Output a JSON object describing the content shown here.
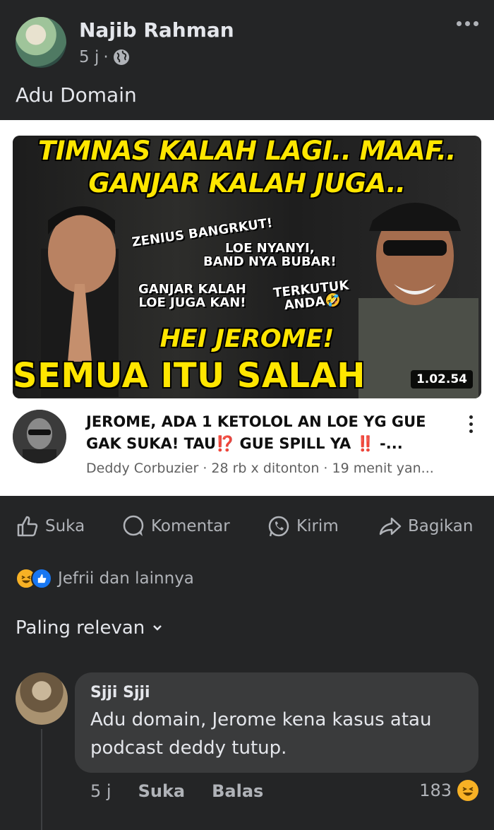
{
  "post": {
    "author": "Najib Rahman",
    "time": "5 j",
    "text": "Adu Domain"
  },
  "link_card": {
    "thumbnail": {
      "headline_1": "TIMNAS KALAH LAGI.. MAAF..",
      "headline_2": "GANJAR KALAH JUGA..",
      "caption_1": "ZENIUS BANGRKUT!",
      "caption_2_line1": "LOE NYANYI,",
      "caption_2_line2": "BAND NYA BUBAR!",
      "caption_3_line1": "GANJAR KALAH",
      "caption_3_line2": "LOE JUGA KAN!",
      "caption_4_line1": "TERKUTUK",
      "caption_4_line2": "ANDA🤣",
      "headline_3": "HEI JEROME!",
      "headline_4": "SEMUA ITU SALAH LOE!!!",
      "duration": "1.02.54"
    },
    "video_title": "JEROME, ADA 1 KETOLOL AN LOE YG GUE GAK SUKA! TAU⁉️ GUE SPILL YA ‼️ -...",
    "video_meta": "Deddy Corbuzier · 28 rb x ditonton · 19 menit yan..."
  },
  "actions": {
    "like": "Suka",
    "comment": "Komentar",
    "send": "Kirim",
    "share": "Bagikan"
  },
  "reactions": {
    "summary": "Jefrii dan lainnya"
  },
  "sort_label": "Paling relevan",
  "comment": {
    "name": "Sjji Sjji",
    "text": "Adu domain, Jerome kena kasus atau podcast deddy tutup.",
    "time": "5 j",
    "like": "Suka",
    "reply": "Balas",
    "count": "183"
  },
  "colors": {
    "background": "#18191a",
    "card": "#242526",
    "bubble": "#3a3b3c",
    "thumbnail_yellow": "#ffe600",
    "haha": "#f7b125",
    "like_blue": "#1877f2"
  }
}
